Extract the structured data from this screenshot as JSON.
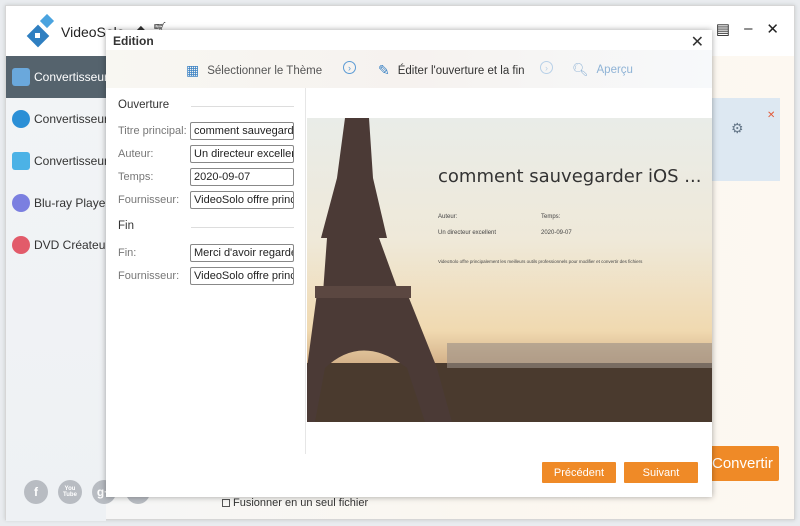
{
  "app": {
    "name": "VideoSolo",
    "convert_label": "Convertir",
    "merge_label": "Fusionner en un seul fichier"
  },
  "sidebar": {
    "items": [
      {
        "label": "Convertisseur Vidéo",
        "active": true
      },
      {
        "label": "Convertisseur Vidéo"
      },
      {
        "label": "Convertisseur Vidéo"
      },
      {
        "label": "Blu-ray Player"
      },
      {
        "label": "DVD Créateur"
      }
    ]
  },
  "social": [
    "f",
    "You Tube",
    "g+",
    "t"
  ],
  "dialog": {
    "title": "Edition",
    "steps": {
      "theme": "Sélectionner le Thème",
      "edit": "Éditer l'ouverture et la fin",
      "preview": "Aperçu"
    },
    "opening": {
      "section": "Ouverture",
      "main_title_label": "Titre principal:",
      "main_title": "comment sauvegarder iOS ...",
      "author_label": "Auteur:",
      "author": "Un directeur excellent",
      "time_label": "Temps:",
      "time": "2020-09-07",
      "provider_label": "Fournisseur:",
      "provider": "VideoSolo offre principalement"
    },
    "ending": {
      "section": "Fin",
      "end_label": "Fin:",
      "end": "Merci d'avoir regardé",
      "provider_label": "Fournisseur:",
      "provider": "VideoSolo offre principalement"
    },
    "preview": {
      "title": "comment sauvegarder  iOS ...",
      "author_label": "Auteur:",
      "author": "Un directeur excellent",
      "time_label": "Temps:",
      "time": "2020-09-07",
      "description": "VideoSolo offre principalement les meilleurs outils professionnels pour modifier et convertir des fichiers"
    },
    "prev_label": "Précédent",
    "next_label": "Suivant"
  },
  "colors": {
    "accent": "#ef8a27",
    "sidebar_active": "#55636d",
    "link": "#5b9bd5"
  }
}
